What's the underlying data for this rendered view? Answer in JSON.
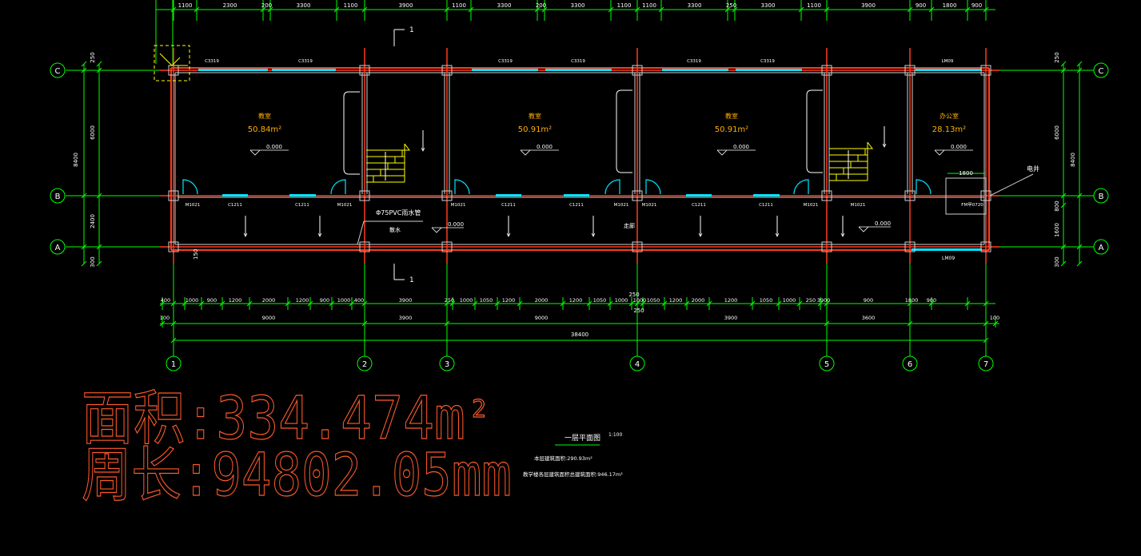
{
  "colors": {
    "background": "#000000",
    "dimension": "#00ff00",
    "wall": "#ff3b1f",
    "column": "#cfcfcf",
    "window": "#00e5ff",
    "room_label": "#ffb000",
    "text": "#ffffff",
    "stair": "#ffff00",
    "big_text": "#ff5a2a"
  },
  "grid_columns": [
    "1",
    "2",
    "3",
    "4",
    "5",
    "6",
    "7"
  ],
  "grid_rows": [
    "A",
    "B",
    "C"
  ],
  "top_dims": [
    "1100",
    "2300",
    "200",
    "3300",
    "1100",
    "3900",
    "1100",
    "3300",
    "200",
    "3300",
    "1100",
    "1100",
    "3300",
    "250",
    "3300",
    "1100",
    "3900",
    "900",
    "1800",
    "900"
  ],
  "bottom_dims_1": [
    "400",
    "1000",
    "900",
    "1200",
    "2000",
    "1200",
    "900",
    "1000",
    "400",
    "3900",
    "250",
    "1000",
    "1050",
    "1200",
    "2000",
    "1200",
    "1050",
    "1000",
    "1000",
    "1050",
    "1200",
    "2000",
    "1200",
    "1050",
    "1000",
    "250",
    "3900",
    "900",
    "1800",
    "900"
  ],
  "bottom_dims_2": [
    "100",
    "9000",
    "3900",
    "9000",
    "3900",
    "3600",
    "100"
  ],
  "total_dim": "38400",
  "mid_dim_250a": "250",
  "mid_dim_250b": "250",
  "left_dims": [
    "250",
    "6000",
    "8400",
    "2400",
    "300"
  ],
  "right_dims": [
    "250",
    "6000",
    "8400",
    "800",
    "1600",
    "300"
  ],
  "rooms": [
    {
      "name": "教室",
      "area": "50.84m²",
      "elev": "0.000"
    },
    {
      "name": "教室",
      "area": "50.91m²",
      "elev": "0.000"
    },
    {
      "name": "教室",
      "area": "50.91m²",
      "elev": "0.000"
    },
    {
      "name": "办公室",
      "area": "28.13m²",
      "elev": "0.000"
    }
  ],
  "window_tags_top": [
    "C3319",
    "C3319",
    "C3319",
    "C3319",
    "C3319",
    "C3319",
    "LM09"
  ],
  "corridor_tags": [
    "M1021",
    "C1211",
    "C1211",
    "M1021",
    "M1021",
    "C1211",
    "C1211",
    "M1021",
    "M1021",
    "C1211",
    "C1211",
    "M1021",
    "M1021",
    "FM甲0720"
  ],
  "corridor_elev": [
    "0.000",
    "0.000"
  ],
  "pvc_note": "Φ75PVC雨水管",
  "pvc_sub": "散水",
  "corridor_word": "走廊",
  "dim_1800": "1800",
  "label_150": "150",
  "label_elec": "电井",
  "section_mark": "1",
  "title": "一层平面图",
  "scale": "1:100",
  "note_1": "本层建筑面积:290.93m²",
  "note_2": "教学楼各层建筑面积总建筑面积:946.17m²",
  "big_area": "面积:334.474m",
  "big_area_sup": "2",
  "big_perimeter": "周长:94802.05mm",
  "lm_bottom": "LM09"
}
